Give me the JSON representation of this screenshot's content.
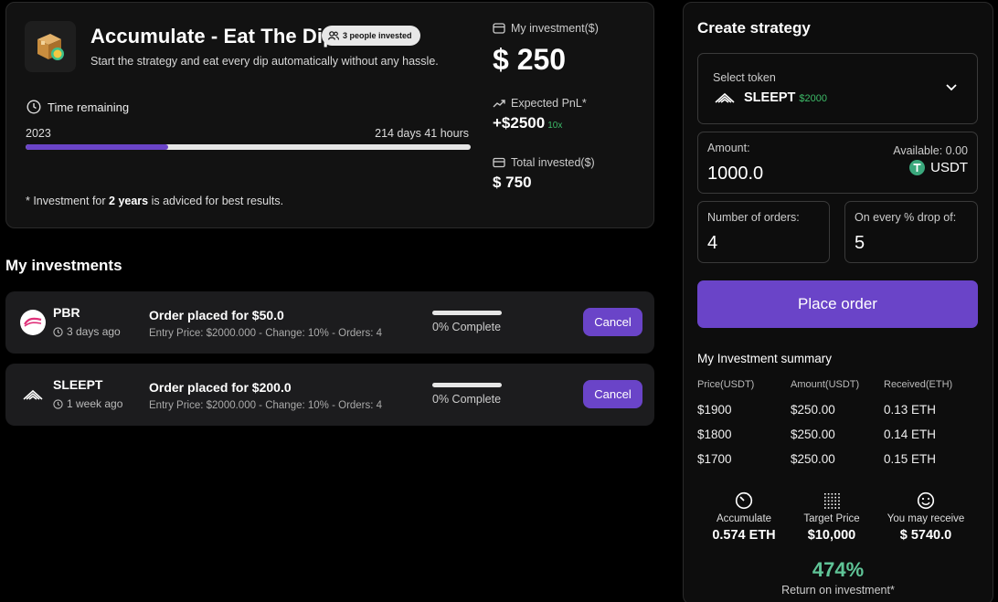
{
  "strategy": {
    "title": "Accumulate - Eat The Dip",
    "badge": "3 people invested",
    "subtitle": "Start the strategy and eat every dip automatically without any hassle.",
    "time_label": "Time remaining",
    "year": "2023",
    "days_left": "214 days 41 hours",
    "progress_fraction": 0.32,
    "note_prefix": "* Investment for ",
    "note_bold": "2 years",
    "note_suffix": " is adviced for best results.",
    "my_investment_label": "My investment($)",
    "my_investment_value": "$ 250",
    "expected_pnl_label": "Expected PnL*",
    "expected_pnl_value": "+$2500",
    "expected_pnl_multiplier": "10x",
    "total_invested_label": "Total invested($)",
    "total_invested_value": "$ 750"
  },
  "investments": {
    "title": "My investments",
    "items": [
      {
        "name": "PBR",
        "time": "3 days ago",
        "order": "Order placed for $50.0",
        "detail": "Entry Price: $2000.000 - Change: 10% - Orders: 4",
        "complete": "0% Complete",
        "complete_fraction": 0.0,
        "cancel_label": "Cancel"
      },
      {
        "name": "SLEEPT",
        "time": "1 week ago",
        "order": "Order placed for $200.0",
        "detail": "Entry Price: $2000.000 - Change: 10% - Orders: 4",
        "complete": "0% Complete",
        "complete_fraction": 0.0,
        "cancel_label": "Cancel"
      }
    ]
  },
  "create": {
    "title": "Create strategy",
    "select_token_label": "Select token",
    "token_name": "SLEEPT",
    "token_price": "$2000",
    "amount_label": "Amount:",
    "amount_value": "1000.0",
    "available": "Available: 0.00",
    "currency": "USDT",
    "orders_label": "Number of orders:",
    "orders_value": "4",
    "drop_label": "On every % drop of:",
    "drop_value": "5",
    "place_order": "Place order"
  },
  "summary": {
    "title": "My Investment summary",
    "headers": [
      "Price(USDT)",
      "Amount(USDT)",
      "Received(ETH)"
    ],
    "rows": [
      [
        "$1900",
        "$250.00",
        "0.13 ETH"
      ],
      [
        "$1800",
        "$250.00",
        "0.14 ETH"
      ],
      [
        "$1700",
        "$250.00",
        "0.15 ETH"
      ]
    ],
    "kpis": [
      {
        "icon": "timer-icon",
        "label": "Accumulate",
        "value": "0.574 ETH"
      },
      {
        "icon": "dot-grid-icon",
        "label": "Target Price",
        "value": "$10,000"
      },
      {
        "icon": "smiley-icon",
        "label": "You may receive",
        "value": "$ 5740.0"
      }
    ],
    "roi": "474%",
    "roi_label": "Return on investment*"
  },
  "colors": {
    "accent": "#6a44c8",
    "positive": "#3dbb68",
    "roi": "#5fc497",
    "card_bg": "#121212",
    "page_bg": "#000000"
  }
}
